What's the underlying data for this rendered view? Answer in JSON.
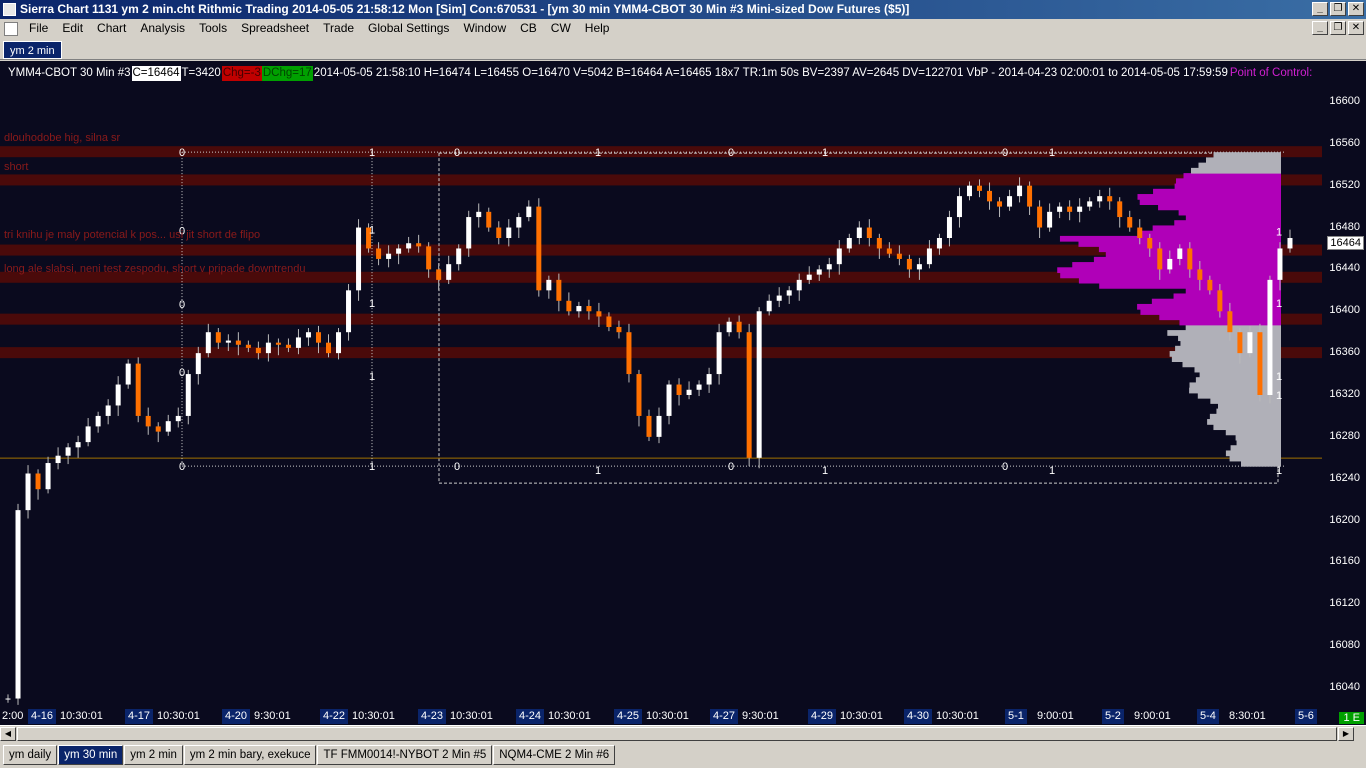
{
  "window": {
    "title": "Sierra Chart 1131 ym 2 min.cht  Rithmic Trading 2014-05-05  21:58:12 Mon [Sim]  Con:670531 - [ym 30 min  YMM4-CBOT  30 Min  #3  Mini-sized Dow Futures ($5)]",
    "minimize": "_",
    "restore": "❐",
    "close": "✕"
  },
  "menu": [
    "File",
    "Edit",
    "Chart",
    "Analysis",
    "Tools",
    "Spreadsheet",
    "Trade",
    "Global Settings",
    "Window",
    "CB",
    "CW",
    "Help"
  ],
  "top_tab": "ym 2 min",
  "info": {
    "symbol": "YMM4-CBOT  30 Min   #3",
    "c": "C=16464",
    "t": "T=3420",
    "chg": "Chg=-3",
    "dchg": "DChg=17",
    "rest": "2014-05-05 21:58:10 H=16474 L=16455 O=16470 V=5042 B=16464 A=16465 18x7 TR:1m 50s BV=2397 AV=2645 DV=122701 VbP - 2014-04-23  02:00:01 to 2014-05-05  17:59:59",
    "poc": "Point of Control:"
  },
  "annotations": [
    "dlouhodobe hig, silna sr",
    "short",
    "tri knihu je maly potencial k pos... usi jit short de flipo",
    "long ale slabsi, neni test zespodu, short v pripade downtrendu"
  ],
  "price_axis": {
    "ticks": [
      16600,
      16560,
      16520,
      16480,
      16440,
      16400,
      16360,
      16320,
      16280,
      16240,
      16200,
      16160,
      16120,
      16080,
      16040
    ],
    "last": "16464"
  },
  "time_axis": {
    "labels": [
      {
        "date": "",
        "time": "2:00"
      },
      {
        "date": "4-16",
        "time": "10:30:01"
      },
      {
        "date": "4-17",
        "time": "10:30:01"
      },
      {
        "date": "4-20",
        "time": "9:30:01"
      },
      {
        "date": "4-22",
        "time": "10:30:01"
      },
      {
        "date": "4-23",
        "time": "10:30:01"
      },
      {
        "date": "4-24",
        "time": "10:30:01"
      },
      {
        "date": "4-25",
        "time": "10:30:01"
      },
      {
        "date": "4-27",
        "time": "9:30:01"
      },
      {
        "date": "4-29",
        "time": "10:30:01"
      },
      {
        "date": "4-30",
        "time": "10:30:01"
      },
      {
        "date": "5-1",
        "time": "9:00:01"
      },
      {
        "date": "5-2",
        "time": "9:00:01"
      },
      {
        "date": "5-4",
        "time": "8:30:01"
      },
      {
        "date": "5-6",
        "time": ""
      }
    ],
    "indicator": "1 E"
  },
  "bottom_tabs": [
    {
      "label": "ym daily",
      "active": false
    },
    {
      "label": "ym 30 min",
      "active": true
    },
    {
      "label": "ym 2 min",
      "active": false
    },
    {
      "label": "ym 2 min bary, exekuce",
      "active": false
    },
    {
      "label": "TF  FMM0014!-NYBOT  2 Min   #5",
      "active": false
    },
    {
      "label": "NQM4-CME  2 Min   #6",
      "active": false
    }
  ],
  "chart_data": {
    "type": "candlestick",
    "symbol": "YMM4-CBOT",
    "interval": "30 Min",
    "ylim": [
      16020,
      16620
    ],
    "price_levels": [
      16552,
      16525,
      16458,
      16432,
      16392,
      16360
    ],
    "vbp_range": [
      16252,
      16552
    ],
    "close_path": [
      16030,
      16210,
      16245,
      16230,
      16255,
      16262,
      16270,
      16275,
      16290,
      16300,
      16310,
      16330,
      16350,
      16300,
      16290,
      16285,
      16295,
      16300,
      16340,
      16360,
      16380,
      16370,
      16372,
      16368,
      16365,
      16360,
      16370,
      16368,
      16365,
      16375,
      16380,
      16370,
      16360,
      16380,
      16420,
      16480,
      16460,
      16450,
      16455,
      16460,
      16465,
      16462,
      16440,
      16430,
      16445,
      16460,
      16490,
      16495,
      16480,
      16470,
      16480,
      16490,
      16500,
      16420,
      16430,
      16410,
      16400,
      16405,
      16400,
      16395,
      16385,
      16380,
      16340,
      16300,
      16280,
      16300,
      16330,
      16320,
      16325,
      16330,
      16340,
      16380,
      16390,
      16380,
      16260,
      16400,
      16410,
      16415,
      16420,
      16430,
      16435,
      16440,
      16445,
      16460,
      16470,
      16480,
      16470,
      16460,
      16455,
      16450,
      16440,
      16445,
      16460,
      16470,
      16490,
      16510,
      16520,
      16515,
      16505,
      16500,
      16510,
      16520,
      16500,
      16480,
      16495,
      16500,
      16495,
      16500,
      16505,
      16510,
      16505,
      16490,
      16480,
      16470,
      16460,
      16440,
      16450,
      16460,
      16440,
      16430,
      16420,
      16400,
      16380,
      16360,
      16380,
      16320,
      16430,
      16460,
      16470
    ]
  }
}
